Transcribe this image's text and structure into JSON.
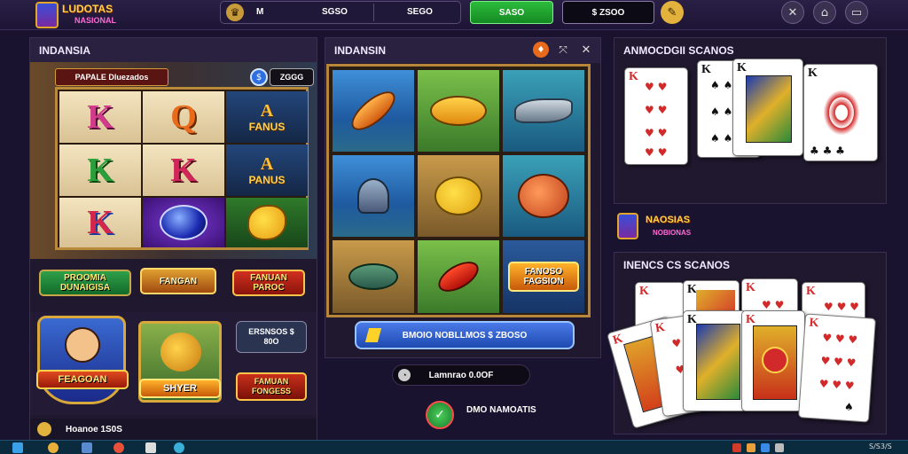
{
  "header": {
    "logo_line1": "LUDOTAS",
    "logo_line2": "NASIONAL",
    "nav_a": "M",
    "nav_b": "SGSO",
    "nav_c": "SEGO",
    "green_button": "SASO",
    "balance": "$ ZSOO",
    "icons": [
      "trophy-icon",
      "tools-icon",
      "home-icon",
      "wallet-icon"
    ]
  },
  "left_panel": {
    "title": "INDANSIA",
    "sub_banner": "PAPALE  Dluezados",
    "value": "ZGGG",
    "reel_symbols": [
      [
        "K",
        "Q",
        "A"
      ],
      [
        "K",
        "K",
        "A"
      ],
      [
        "K",
        "",
        ""
      ]
    ],
    "symbol_caption_1": "FANUS",
    "symbol_caption_2": "PANUS",
    "banners": [
      "PROOMIA DUNAIGISA",
      "FANGAN",
      "FANUAN PAROC"
    ],
    "promo_cards": [
      "FEAGOAN",
      "SHYER"
    ],
    "side_box": "ERSNSOS $ 80O",
    "side_banner": "FAMUAN FONGESS",
    "footer": "Hoanoe  1S0S"
  },
  "middle_panel": {
    "title": "INDANSIN",
    "fish_label": "FANOSO FAGSION",
    "bar_text": "BMOIO NOBLLMOS $ ZBOSO",
    "pill_text": "Lamnrao 0.0OF",
    "bottom_text": "DMO NAMOATIS"
  },
  "right_panel": {
    "title_1": "ANMOCDGII SCANOS",
    "logo_text": "NAOSIAS",
    "logo_sub": "NOBIONAS",
    "title_2": "INENCS CS SCANOS"
  },
  "taskbar": {
    "clock": "S/S3/S"
  }
}
